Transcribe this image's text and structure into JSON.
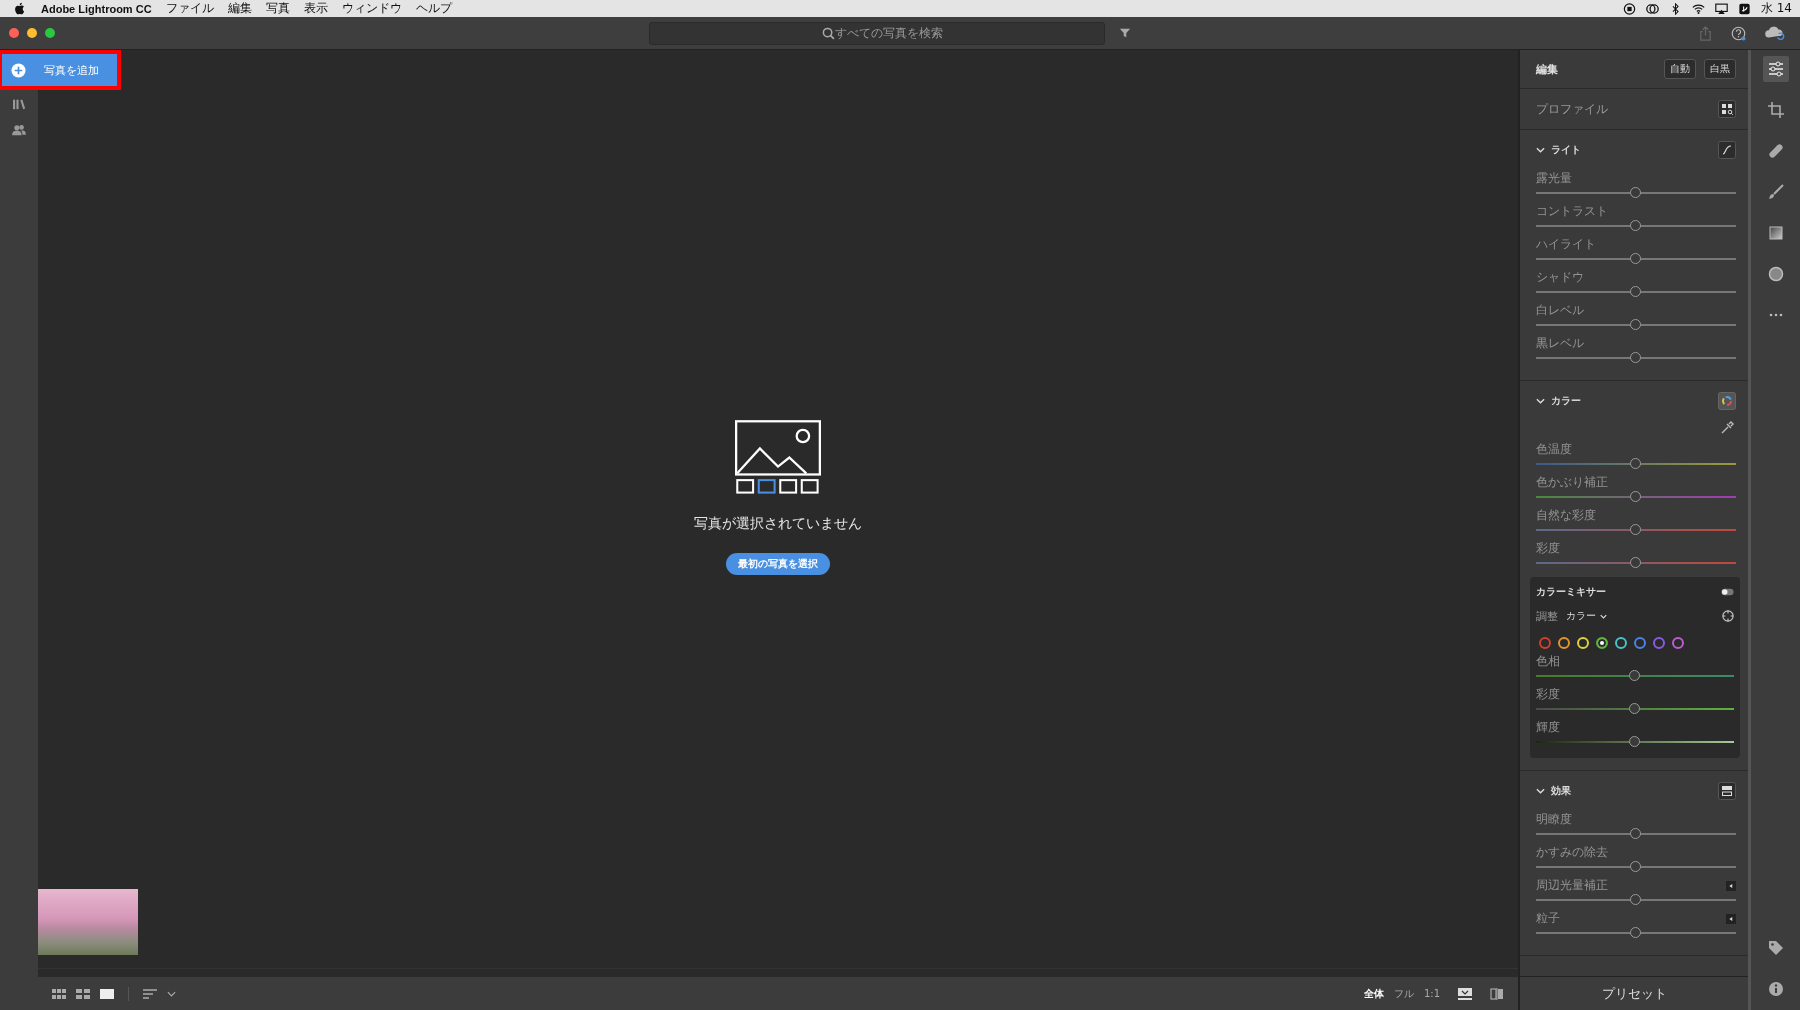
{
  "menu_bar": {
    "app_name": "Adobe Lightroom CC",
    "menus": [
      "ファイル",
      "編集",
      "写真",
      "表示",
      "ウィンドウ",
      "ヘルプ"
    ],
    "clock": "水 14"
  },
  "toolbar": {
    "search": {
      "placeholder": "すべての写真を検索"
    }
  },
  "sidebar": {
    "add_button": {
      "label": "写真を追加",
      "highlighted": true
    }
  },
  "empty_state": {
    "message": "写真が選択されていません",
    "button": "最初の写真を選択"
  },
  "bottom_bar": {
    "zoom_options": [
      {
        "label": "全体",
        "selected": true
      },
      {
        "label": "フル",
        "selected": false
      },
      {
        "label": "1:1",
        "selected": false
      }
    ]
  },
  "edit": {
    "title": "編集",
    "buttons": [
      "自動",
      "白黒"
    ],
    "profile_label": "プロファイル",
    "sections": [
      {
        "kind": "light",
        "title": "ライト",
        "expanded": true,
        "sliders": [
          {
            "label": "露光量",
            "level": 0.5
          },
          {
            "label": "コントラスト",
            "level": 0.5
          },
          {
            "label": "ハイライト",
            "level": 0.5
          },
          {
            "label": "シャドウ",
            "level": 0.5
          },
          {
            "label": "白レベル",
            "level": 0.5
          },
          {
            "label": "黒レベル",
            "level": 0.5
          }
        ]
      },
      {
        "kind": "color",
        "title": "カラー",
        "expanded": true,
        "sliders": [
          {
            "label": "色温度",
            "level": 0.5,
            "kind": "temperature"
          },
          {
            "label": "色かぶり補正",
            "level": 0.5,
            "kind": "tint"
          },
          {
            "label": "自然な彩度",
            "level": 0.5,
            "kind": "saturation"
          },
          {
            "label": "彩度",
            "level": 0.5,
            "kind": "saturation"
          }
        ],
        "mixer": {
          "title": "カラーミキサー",
          "adjust_label": "調整",
          "adjust_value": "カラー",
          "swatches": [
            {
              "color": "#d0402c",
              "selected": false
            },
            {
              "color": "#e0962c",
              "selected": false
            },
            {
              "color": "#dcd23c",
              "selected": false
            },
            {
              "color": "#5cb43c",
              "selected": true
            },
            {
              "color": "#4cc0c8",
              "selected": false
            },
            {
              "color": "#4c82e6",
              "selected": false
            },
            {
              "color": "#8a5ae0",
              "selected": false
            },
            {
              "color": "#c05ad2",
              "selected": false
            }
          ],
          "sliders": [
            {
              "label": "色相",
              "level": 0.5,
              "kind": "hue"
            },
            {
              "label": "彩度",
              "level": 0.5,
              "kind": "chroma"
            },
            {
              "label": "輝度",
              "level": 0.5,
              "kind": "luminance"
            }
          ]
        }
      },
      {
        "kind": "effects",
        "title": "効果",
        "expanded": true,
        "sliders": [
          {
            "label": "明瞭度",
            "level": 0.5,
            "expandable": false
          },
          {
            "label": "かすみの除去",
            "level": 0.5,
            "expandable": false
          },
          {
            "label": "周辺光量補正",
            "level": 0.5,
            "expandable": true
          },
          {
            "label": "粒子",
            "level": 0.5,
            "expandable": true
          }
        ]
      }
    ],
    "presets": "プリセット"
  }
}
